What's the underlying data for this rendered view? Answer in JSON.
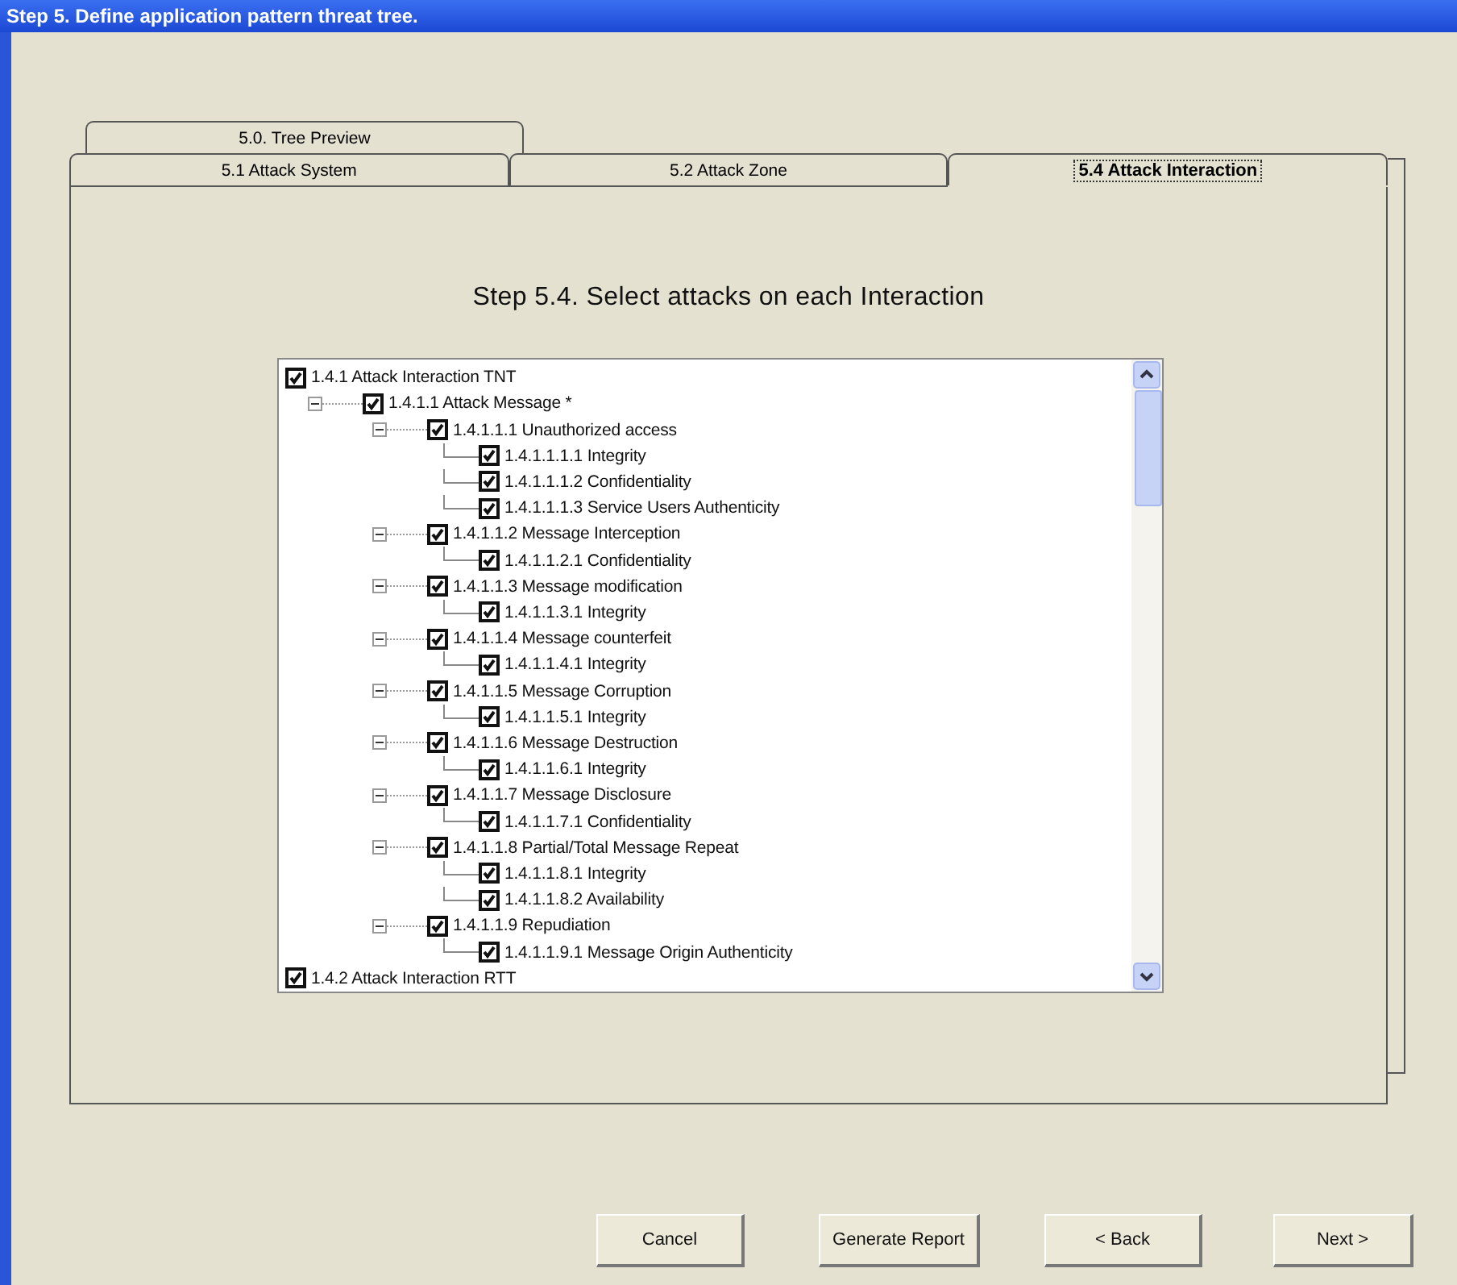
{
  "window": {
    "title": "Step 5. Define application pattern threat tree."
  },
  "back_tabs": [
    {
      "label": "5.0. Tree Preview",
      "selected": false
    }
  ],
  "tabs": [
    {
      "label": "5.1 Attack System",
      "selected": false
    },
    {
      "label": "5.2 Attack Zone",
      "selected": false
    },
    {
      "label": "5.4 Attack Interaction",
      "selected": true
    }
  ],
  "heading": "Step 5.4. Select attacks on each Interaction",
  "tree": [
    {
      "label": "1.4.1 Attack Interaction TNT",
      "checked": true,
      "children": [
        {
          "label": "1.4.1.1 Attack Message *",
          "checked": true,
          "expanded": true,
          "children": [
            {
              "label": "1.4.1.1.1 Unauthorized access",
              "checked": true,
              "expanded": true,
              "children": [
                {
                  "label": "1.4.1.1.1.1 Integrity",
                  "checked": true
                },
                {
                  "label": "1.4.1.1.1.2 Confidentiality",
                  "checked": true
                },
                {
                  "label": "1.4.1.1.1.3 Service Users Authenticity",
                  "checked": true
                }
              ]
            },
            {
              "label": "1.4.1.1.2 Message Interception",
              "checked": true,
              "expanded": true,
              "children": [
                {
                  "label": "1.4.1.1.2.1 Confidentiality",
                  "checked": true
                }
              ]
            },
            {
              "label": "1.4.1.1.3 Message modification",
              "checked": true,
              "expanded": true,
              "children": [
                {
                  "label": "1.4.1.1.3.1 Integrity",
                  "checked": true
                }
              ]
            },
            {
              "label": "1.4.1.1.4 Message counterfeit",
              "checked": true,
              "expanded": true,
              "children": [
                {
                  "label": "1.4.1.1.4.1 Integrity",
                  "checked": true
                }
              ]
            },
            {
              "label": "1.4.1.1.5 Message Corruption",
              "checked": true,
              "expanded": true,
              "children": [
                {
                  "label": "1.4.1.1.5.1 Integrity",
                  "checked": true
                }
              ]
            },
            {
              "label": "1.4.1.1.6 Message Destruction",
              "checked": true,
              "expanded": true,
              "children": [
                {
                  "label": "1.4.1.1.6.1 Integrity",
                  "checked": true
                }
              ]
            },
            {
              "label": "1.4.1.1.7 Message Disclosure",
              "checked": true,
              "expanded": true,
              "children": [
                {
                  "label": "1.4.1.1.7.1 Confidentiality",
                  "checked": true
                }
              ]
            },
            {
              "label": "1.4.1.1.8 Partial/Total Message Repeat",
              "checked": true,
              "expanded": true,
              "children": [
                {
                  "label": "1.4.1.1.8.1 Integrity",
                  "checked": true
                },
                {
                  "label": "1.4.1.1.8.2 Availability",
                  "checked": true
                }
              ]
            },
            {
              "label": "1.4.1.1.9 Repudiation",
              "checked": true,
              "expanded": true,
              "children": [
                {
                  "label": "1.4.1.1.9.1 Message Origin Authenticity",
                  "checked": true
                }
              ]
            }
          ]
        }
      ]
    },
    {
      "label": "1.4.2 Attack Interaction RTT",
      "checked": true
    }
  ],
  "buttons": [
    "Cancel",
    "Generate Report",
    "< Back",
    "Next >"
  ]
}
